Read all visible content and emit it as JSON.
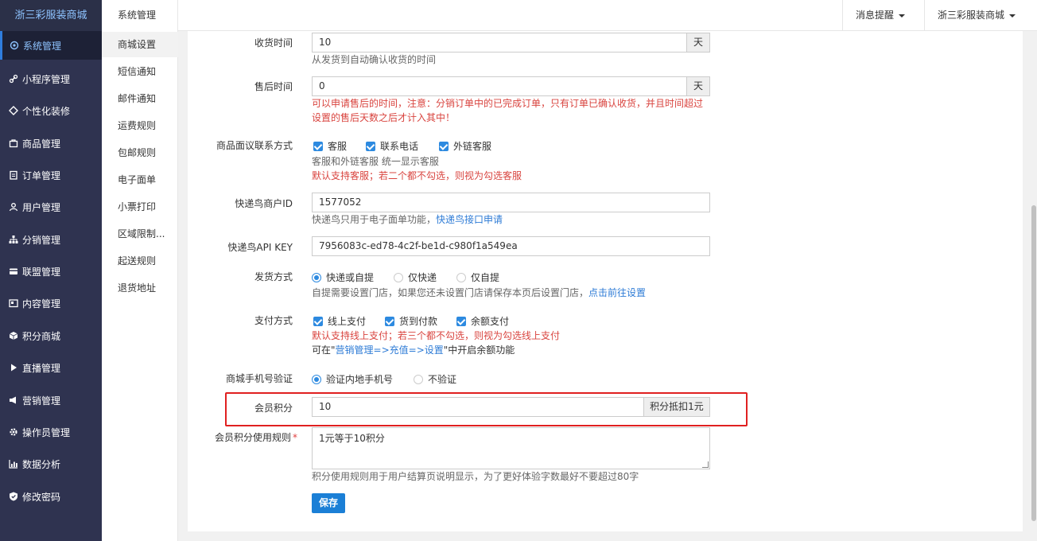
{
  "sidebar": {
    "brand": "浙三彩服装商城",
    "items": [
      {
        "label": "系统管理",
        "icon": "gear-circle-icon"
      },
      {
        "label": "小程序管理",
        "icon": "link-icon"
      },
      {
        "label": "个性化装修",
        "icon": "diamond-icon"
      },
      {
        "label": "商品管理",
        "icon": "bag-icon"
      },
      {
        "label": "订单管理",
        "icon": "clipboard-icon"
      },
      {
        "label": "用户管理",
        "icon": "user-icon"
      },
      {
        "label": "分销管理",
        "icon": "sitemap-icon"
      },
      {
        "label": "联盟管理",
        "icon": "card-icon"
      },
      {
        "label": "内容管理",
        "icon": "newspaper-icon"
      },
      {
        "label": "积分商城",
        "icon": "cube-icon"
      },
      {
        "label": "直播管理",
        "icon": "play-icon"
      },
      {
        "label": "营销管理",
        "icon": "megaphone-icon"
      },
      {
        "label": "操作员管理",
        "icon": "gear-icon"
      },
      {
        "label": "数据分析",
        "icon": "bar-chart-icon"
      },
      {
        "label": "修改密码",
        "icon": "shield-icon"
      }
    ]
  },
  "submenu": {
    "heading": "系统管理",
    "items": [
      "商城设置",
      "短信通知",
      "邮件通知",
      "运费规则",
      "包邮规则",
      "电子面单",
      "小票打印",
      "区域限制...",
      "起送规则",
      "退货地址"
    ]
  },
  "header": {
    "notifications": "消息提醒",
    "store": "浙三彩服装商城"
  },
  "form": {
    "receive_time": {
      "label": "收货时间",
      "value": "10",
      "unit": "天",
      "help": "从发货到自动确认收货的时间"
    },
    "after_sale": {
      "label": "售后时间",
      "value": "0",
      "unit": "天",
      "help_prefix": "可以申请售后的时间，",
      "help_warn1": "注意：分销订单中的已完成订单，只有订单已确认收货，并且时间超过",
      "help_warn2": "设置的售后天数之后才计入其中！"
    },
    "contact": {
      "label": "商品面议联系方式",
      "options": [
        "客服",
        "联系电话",
        "外链客服"
      ],
      "help1": "客服和外链客服 统一显示客服",
      "help2": "默认支持客服；若二个都不勾选，则视为勾选客服"
    },
    "kdn_id": {
      "label": "快递鸟商户ID",
      "value": "1577052",
      "help_prefix": "快递鸟只用于电子面单功能，",
      "help_link": "快递鸟接口申请"
    },
    "kdn_key": {
      "label": "快递鸟API KEY",
      "value": "7956083c-ed78-4c2f-be1d-c980f1a549ea"
    },
    "delivery": {
      "label": "发货方式",
      "options": [
        "快递或自提",
        "仅快递",
        "仅自提"
      ],
      "selected": "快递或自提",
      "help_prefix": "自提需要设置门店，如果您还未设置门店请保存本页后设置门店，",
      "help_link": "点击前往设置"
    },
    "payment": {
      "label": "支付方式",
      "options": [
        "线上支付",
        "货到付款",
        "余额支付"
      ],
      "help1": "默认支持线上支付；若三个都不勾选，则视为勾选线上支付",
      "help2_prefix": "可在\"",
      "help2_link": "营销管理=>充值=>设置",
      "help2_suffix": "\"中开启余额功能"
    },
    "phone_verify": {
      "label": "商城手机号验证",
      "options": [
        "验证内地手机号",
        "不验证"
      ],
      "selected": "验证内地手机号"
    },
    "points": {
      "label": "会员积分",
      "value": "10",
      "addon": "积分抵扣1元"
    },
    "points_rule": {
      "label": "会员积分使用规则",
      "required_mark": "*",
      "value": "1元等于10积分",
      "help": "积分使用规则用于用户结算页说明显示，为了更好体验字数最好不要超过80字"
    },
    "save_label": "保存"
  },
  "colors": {
    "sidebar_bg": "#2f3350",
    "accent": "#2d8ae0",
    "warn": "#d9443f",
    "highlight": "#e02020"
  }
}
